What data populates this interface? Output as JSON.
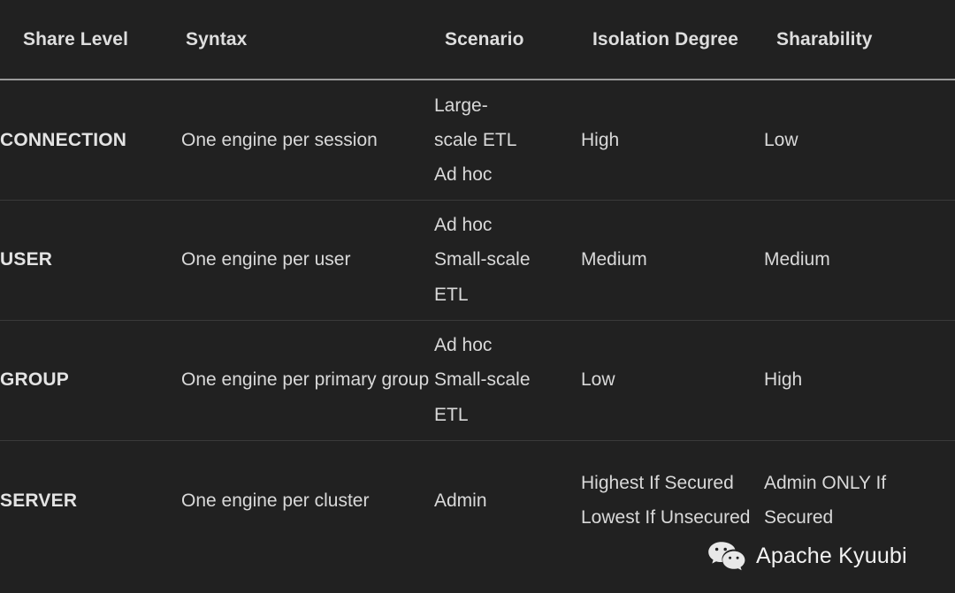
{
  "table": {
    "headers": [
      "Share Level",
      "Syntax",
      "Scenario",
      "Isolation Degree",
      "Sharability"
    ],
    "rows": [
      {
        "share_level": "CONNECTION",
        "syntax": "One engine per session",
        "scenario_lines": [
          "Large-",
          "scale ETL",
          "Ad hoc"
        ],
        "isolation_degree": "High",
        "sharability": "Low"
      },
      {
        "share_level": "USER",
        "syntax": "One engine per user",
        "scenario_lines": [
          "Ad hoc",
          "Small-scale",
          "ETL"
        ],
        "isolation_degree": "Medium",
        "sharability": "Medium"
      },
      {
        "share_level": "GROUP",
        "syntax": "One engine per primary group",
        "scenario_lines": [
          "Ad hoc",
          "Small-scale",
          "ETL"
        ],
        "isolation_degree": "Low",
        "sharability": "High"
      },
      {
        "share_level": "SERVER",
        "syntax": "One engine per cluster",
        "scenario_lines": [
          "Admin"
        ],
        "isolation_degree": "Highest If Secured Lowest If Unsecured",
        "sharability": "Admin ONLY If Secured"
      }
    ]
  },
  "watermark": {
    "icon": "wechat-icon",
    "label": "Apache Kyuubi"
  },
  "colors": {
    "background": "#212121",
    "text": "#d9d9d9",
    "header_rule": "#9a9a9a",
    "row_rule": "#3a3a3a"
  }
}
